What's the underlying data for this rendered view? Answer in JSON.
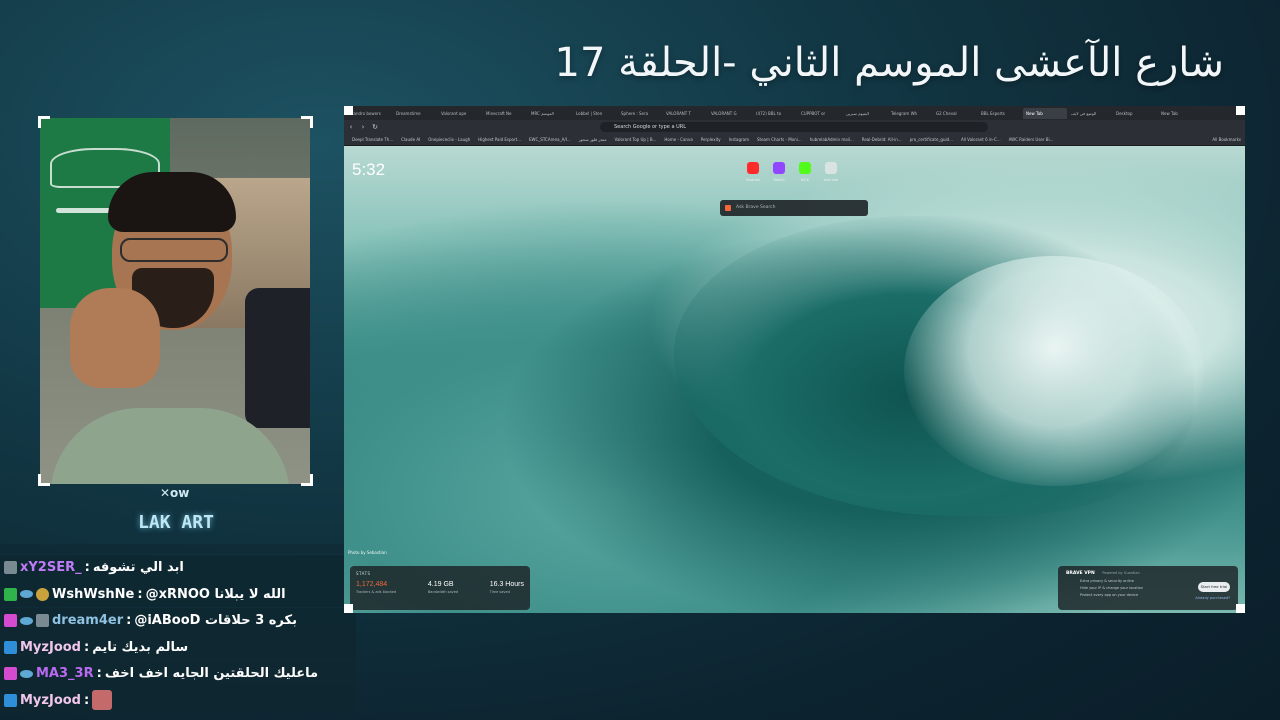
{
  "stream": {
    "title": "شارع الآعشى الموسم الثاني -الحلقة 17",
    "mini_logo": "✕ow",
    "channel_logo": "LAK ART"
  },
  "chat": {
    "messages": [
      {
        "badges": [
          "grey"
        ],
        "user": "xY2SER_",
        "user_color": "#c07cf7",
        "text": "ابد الي تشوفه"
      },
      {
        "badges": [
          "check",
          "link",
          "gold"
        ],
        "user": "WshWshNe",
        "user_color": "#ffffff",
        "text": "@xRNOO الله لا يبلانا"
      },
      {
        "badges": [
          "heart",
          "link",
          "grey"
        ],
        "user": "dream4er",
        "user_color": "#8fc1e0",
        "text": "@iABooD بكره 3 حلاقات"
      },
      {
        "badges": [
          "star"
        ],
        "user": "MyzJood",
        "user_color": "#f0c7ea",
        "text": "سالم بديك تايم"
      },
      {
        "badges": [
          "heart",
          "link"
        ],
        "user": "MA3_3R",
        "user_color": "#b86af0",
        "text": "ماعليك الحلقتين الجايه اخف اخف"
      },
      {
        "badges": [
          "star"
        ],
        "user": "MyzJood",
        "user_color": "#f0c7ea",
        "text": ""
      }
    ]
  },
  "browser": {
    "tabs": [
      "Sandro bowers",
      "Dreamstime",
      "Valorant ope",
      "Minecraft Ne",
      "MRC الموسم",
      "Lobbel | Sten",
      "Sphere : Sera",
      "VALORANT T",
      "VALORANT G",
      "(472) BBL to",
      "CUPPBOT or",
      "لايفيوم سيرين",
      "Telegram Wh",
      "G2 Cheval",
      "BBL Esports",
      "New Tab",
      "الوضع في لايف",
      "Desktop",
      "New Tab"
    ],
    "active_tab_index": 15,
    "url_placeholder": "Search Google or type a URL",
    "bookmarks": [
      "Deepl Translate Th...",
      "Claude AI",
      "Onepiececlix - Laugh",
      "Highest Paid Esport...",
      "EWC_STCArena_A/I...",
      "متجر فلور سحور",
      "Valorant Top Up | B...",
      "Home - Canva",
      "Perplexity",
      "Instagram",
      "Steam Charts - Moni...",
      "hubrelabAdmin mail...",
      "Real-Debrid: All-in...",
      "pro_certificate_guid...",
      "All Valorant 6 in-C...",
      "AWC Raiders User Bi..."
    ],
    "all_bookmarks": "All Bookmarks",
    "clock": "5:32",
    "shortcuts": [
      {
        "label": "Youtube",
        "color": "#ff2a2a"
      },
      {
        "label": "Twitch",
        "color": "#9146ff"
      },
      {
        "label": "KICK",
        "color": "#53fc18"
      },
      {
        "label": "Add site",
        "color": "#d9e3e2"
      }
    ],
    "search_placeholder": "Ask Brave Search",
    "photo_credit": "Photo by Sebastian",
    "stats": {
      "title": "STATS",
      "items": [
        {
          "value": "1,172,484",
          "label": "Trackers & ads blocked"
        },
        {
          "value": "4.19 GB",
          "label": "Bandwidth saved"
        },
        {
          "value": "16.3 Hours",
          "label": "Time saved"
        }
      ]
    },
    "vpn": {
      "title": "BRAVE VPN",
      "powered": "Powered by Guardian",
      "lines": [
        "Extra privacy & security online",
        "Hide your IP & change your location",
        "Protect every app on your device"
      ],
      "button": "Start free trial",
      "link": "Already purchased?"
    }
  }
}
